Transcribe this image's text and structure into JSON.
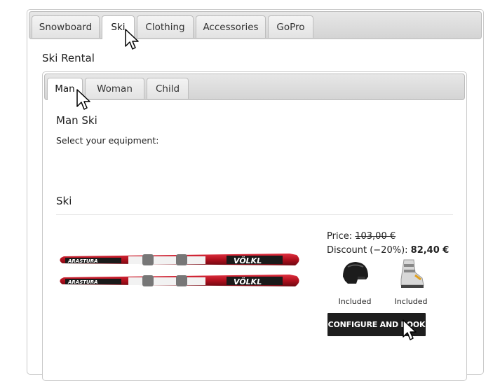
{
  "top_tabs": [
    "Snowboard",
    "Ski",
    "Clothing",
    "Accessories",
    "GoPro"
  ],
  "active_top_tab": "Ski",
  "rental_title": "Ski Rental",
  "sub_tabs": [
    "Man",
    "Woman",
    "Child"
  ],
  "active_sub_tab": "Man",
  "panel": {
    "title": "Man Ski",
    "subtitle": "Select your equipment:",
    "section": "Ski"
  },
  "product": {
    "price_label": "Price:",
    "price_old": "103,00 €",
    "discount_label": "Discount (−20%):",
    "price_new": "82,40 €",
    "ski_brand_left": "ARASTURA",
    "ski_brand_right": "VÖLKL",
    "included": [
      {
        "icon": "helmet-icon",
        "label": "Included"
      },
      {
        "icon": "ski-boot-icon",
        "label": "Included"
      }
    ],
    "button_label": "CONFIGURE AND BOOK"
  },
  "colors": {
    "ski_red": "#c0182a",
    "button_bg": "#1e1e1e"
  }
}
